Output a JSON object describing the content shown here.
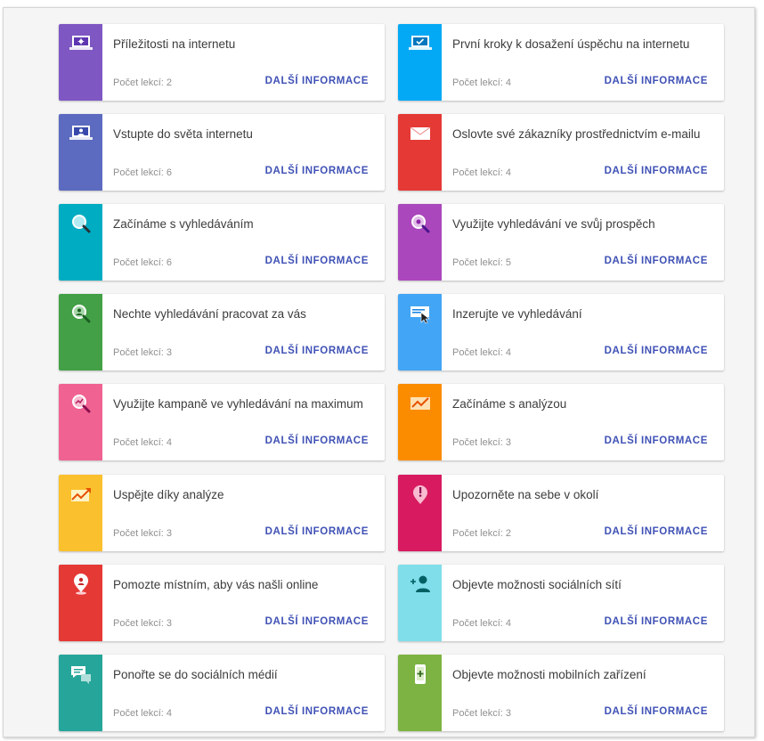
{
  "cards": [
    {
      "title": "Příležitosti na internetu",
      "count": "Počet lekcí: 2",
      "more": "DALŠÍ INFORMACE",
      "color": "#7e57c2",
      "icon": "laptop-sparkle-icon"
    },
    {
      "title": "První kroky k dosažení úspěchu na internetu",
      "count": "Počet lekcí: 4",
      "more": "DALŠÍ INFORMACE",
      "color": "#03a9f4",
      "icon": "laptop-check-icon"
    },
    {
      "title": "Vstupte do světa internetu",
      "count": "Počet lekcí: 6",
      "more": "DALŠÍ INFORMACE",
      "color": "#5c6bc0",
      "icon": "laptop-user-icon"
    },
    {
      "title": "Oslovte své zákazníky prostřednictvím e-mailu",
      "count": "Počet lekcí: 4",
      "more": "DALŠÍ INFORMACE",
      "color": "#e53935",
      "icon": "envelope-icon"
    },
    {
      "title": "Začínáme s vyhledáváním",
      "count": "Počet lekcí: 6",
      "more": "DALŠÍ INFORMACE",
      "color": "#00acc1",
      "icon": "magnifier-icon"
    },
    {
      "title": "Využijte vyhledávání ve svůj prospěch",
      "count": "Počet lekcí: 5",
      "more": "DALŠÍ INFORMACE",
      "color": "#ab47bc",
      "icon": "magnifier-gear-icon"
    },
    {
      "title": "Nechte vyhledávání pracovat za vás",
      "count": "Počet lekcí: 3",
      "more": "DALŠÍ INFORMACE",
      "color": "#43a047",
      "icon": "magnifier-user-icon"
    },
    {
      "title": "Inzerujte ve vyhledávání",
      "count": "Počet lekcí: 4",
      "more": "DALŠÍ INFORMACE",
      "color": "#42a5f5",
      "icon": "ad-cursor-icon"
    },
    {
      "title": "Využijte kampaně ve vyhledávání na maximum",
      "count": "Počet lekcí: 4",
      "more": "DALŠÍ INFORMACE",
      "color": "#f06292",
      "icon": "magnifier-chart-icon"
    },
    {
      "title": "Začínáme s analýzou",
      "count": "Počet lekcí: 3",
      "more": "DALŠÍ INFORMACE",
      "color": "#fb8c00",
      "icon": "trend-chart-icon"
    },
    {
      "title": "Uspějte díky analýze",
      "count": "Počet lekcí: 3",
      "more": "DALŠÍ INFORMACE",
      "color": "#fbc02d",
      "icon": "trend-arrow-icon"
    },
    {
      "title": "Upozorněte na sebe v okolí",
      "count": "Počet lekcí: 2",
      "more": "DALŠÍ INFORMACE",
      "color": "#d81b60",
      "icon": "map-pin-exclamation-icon"
    },
    {
      "title": "Pomozte místním, aby vás našli online",
      "count": "Počet lekcí: 3",
      "more": "DALŠÍ INFORMACE",
      "color": "#e53935",
      "icon": "map-pin-user-icon"
    },
    {
      "title": "Objevte možnosti sociálních sítí",
      "count": "Počet lekcí: 4",
      "more": "DALŠÍ INFORMACE",
      "color": "#80deea",
      "icon": "add-person-icon"
    },
    {
      "title": "Ponořte se do sociálních médií",
      "count": "Počet lekcí: 4",
      "more": "DALŠÍ INFORMACE",
      "color": "#26a69a",
      "icon": "chat-bubbles-icon"
    },
    {
      "title": "Objevte možnosti mobilních zařízení",
      "count": "Počet lekcí: 3",
      "more": "DALŠÍ INFORMACE",
      "color": "#7cb342",
      "icon": "mobile-plus-icon"
    }
  ]
}
